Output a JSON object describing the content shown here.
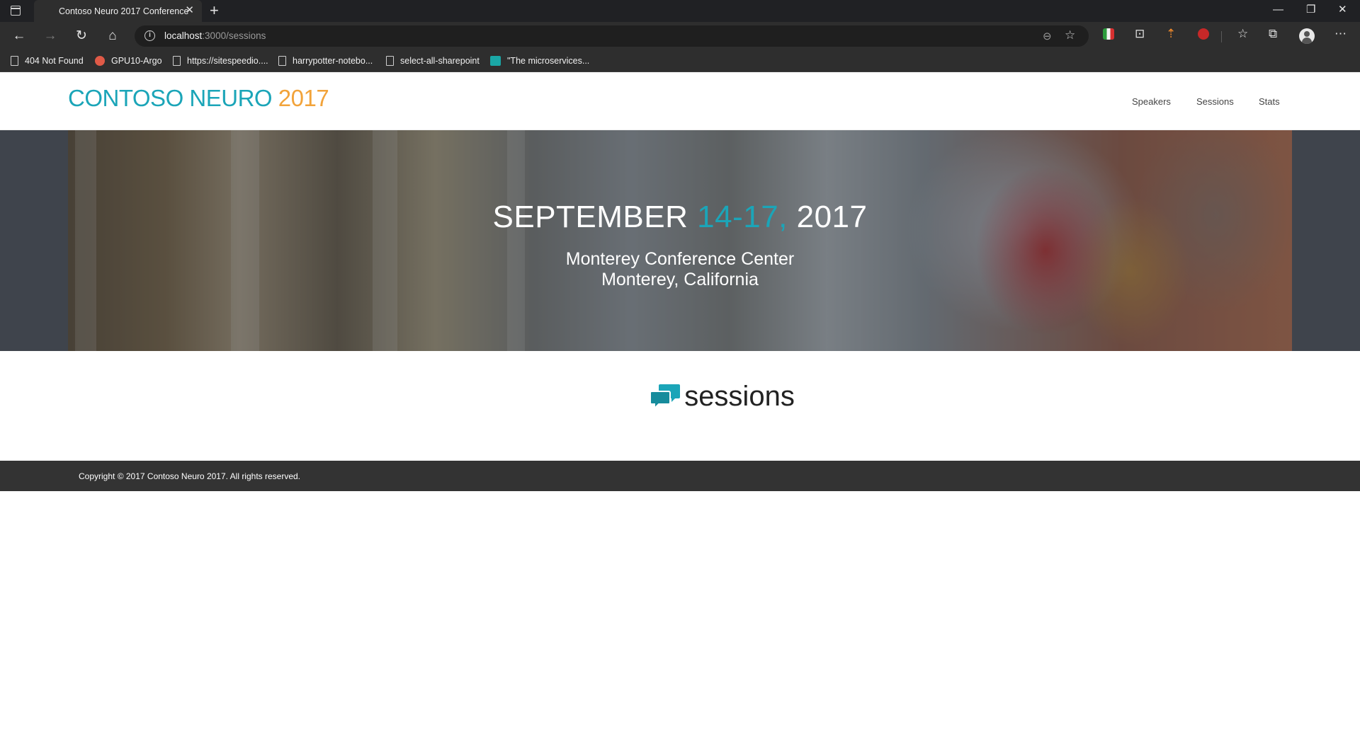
{
  "browser": {
    "tab_title": "Contoso Neuro 2017 Conference",
    "tab_close": "✕",
    "new_tab": "+",
    "window_controls": {
      "minimize": "—",
      "restore": "❐",
      "close": "✕"
    },
    "url_host": "localhost",
    "url_path": ":3000/sessions",
    "bookmarks": [
      {
        "label": "404 Not Found",
        "icon": "page-icon"
      },
      {
        "label": "GPU10-Argo",
        "icon": "argo-icon"
      },
      {
        "label": "https://sitespeedio....",
        "icon": "page-icon"
      },
      {
        "label": "harrypotter-notebo...",
        "icon": "page-icon"
      },
      {
        "label": "select-all-sharepoint",
        "icon": "page-icon"
      },
      {
        "label": "\"The microservices...",
        "icon": "teal-app-icon"
      }
    ]
  },
  "site": {
    "logo_brand": "CONTOSO NEURO ",
    "logo_year": "2017",
    "nav": [
      "Speakers",
      "Sessions",
      "Stats"
    ],
    "colors": {
      "accent": "#1ba5b8",
      "year": "#f2a33a",
      "footer": "#333333"
    }
  },
  "hero": {
    "date_month": "SEPTEMBER ",
    "date_days": "14-17,",
    "date_year": " 2017",
    "venue_line1": "Monterey Conference Center",
    "venue_line2": "Monterey, California"
  },
  "section": {
    "title": "sessions",
    "icon": "chat-bubbles-icon"
  },
  "footer": {
    "copyright": "Copyright © 2017 Contoso Neuro 2017. All rights reserved."
  }
}
